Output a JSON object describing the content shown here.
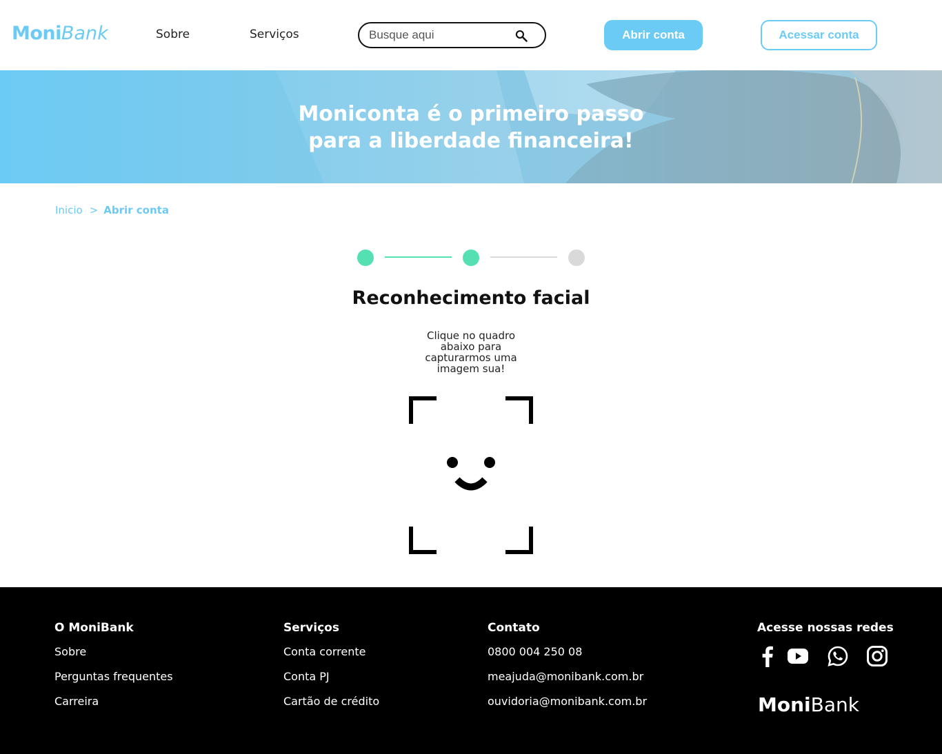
{
  "header": {
    "logo": {
      "moni": "Moni",
      "bank": "Bank"
    },
    "nav": [
      {
        "label": "Sobre"
      },
      {
        "label": "Serviços"
      }
    ],
    "search": {
      "placeholder": "Busque aqui",
      "value": ""
    },
    "open_account_label": "Abrir conta",
    "access_account_label": "Acessar conta"
  },
  "banner": {
    "title_line1": "Moniconta é o primeiro passo",
    "title_line2": "para a liberdade financeira!"
  },
  "breadcrumb": {
    "home": "Inicio",
    "separator": ">",
    "current": "Abrir conta"
  },
  "steps": {
    "total": 3,
    "completed": 2
  },
  "main": {
    "title": "Reconhecimento facial",
    "instruction": "Clique no quadro abaixo para capturarmos uma imagem sua!"
  },
  "footer": {
    "columns": [
      {
        "heading": "O MoniBank",
        "links": [
          "Sobre",
          "Perguntas frequentes",
          "Carreira"
        ]
      },
      {
        "heading": "Serviços",
        "links": [
          "Conta corrente",
          "Conta PJ",
          "Cartão de crédito"
        ]
      },
      {
        "heading": "Contato",
        "links": [
          "0800 004 250 08",
          "meajuda@monibank.com.br",
          "ouvidoria@monibank.com.br"
        ]
      }
    ],
    "social_heading": "Acesse nossas redes",
    "social_icons": [
      "facebook-icon",
      "youtube-icon",
      "whatsapp-icon",
      "instagram-icon"
    ],
    "logo": {
      "moni": "Moni",
      "bank": "Bank"
    }
  },
  "colors": {
    "brand_blue": "#6CCBF4",
    "step_active": "#55E0B4",
    "step_inactive": "#D9D9D9",
    "footer_bg": "#000000"
  }
}
